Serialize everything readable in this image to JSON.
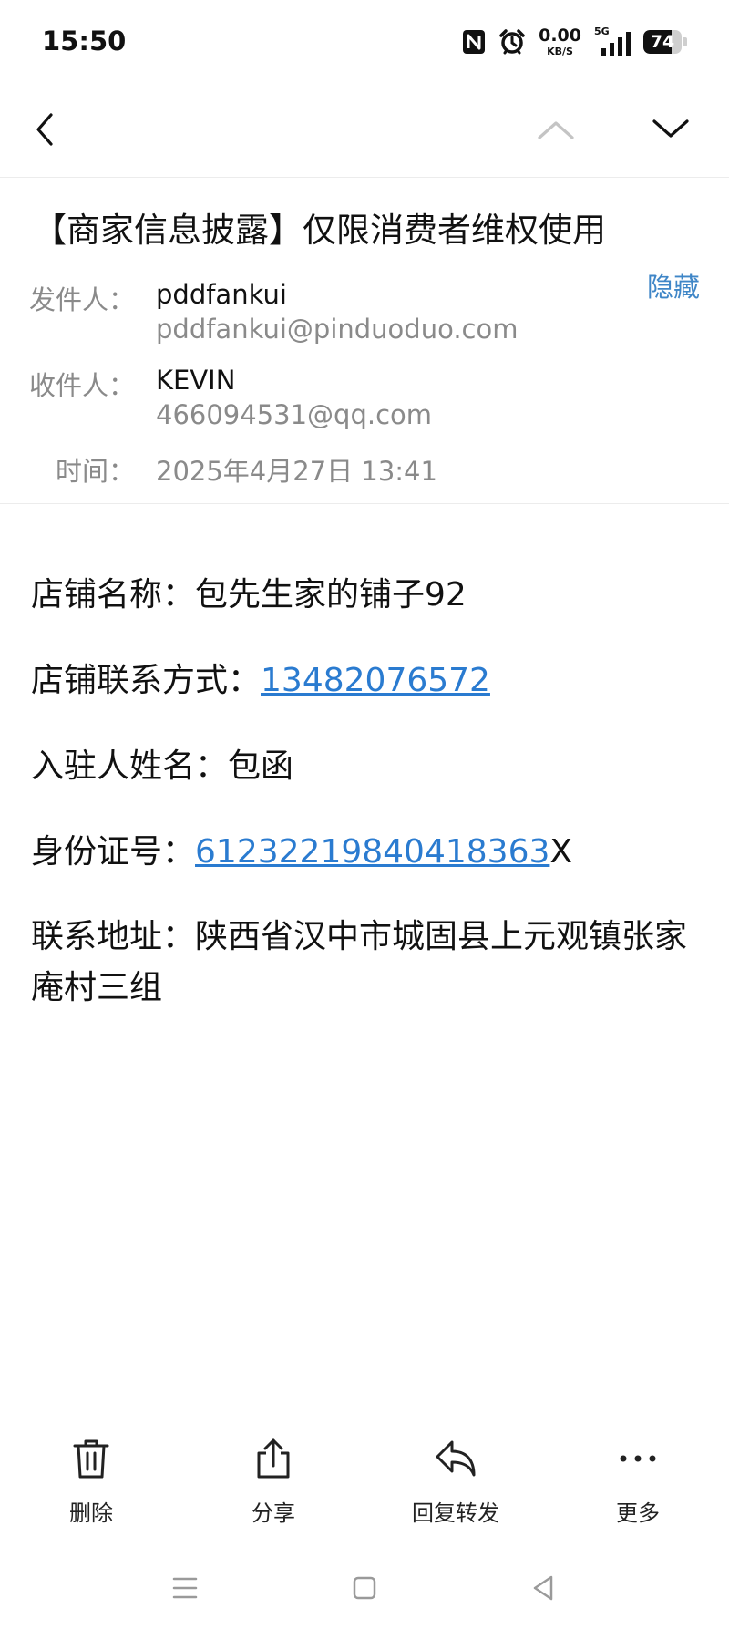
{
  "status_bar": {
    "time": "15:50",
    "net_speed_value": "0.00",
    "net_speed_unit": "KB/S",
    "network_type": "5G",
    "battery_level": "74",
    "battery_fraction": 0.74,
    "icons": [
      "nfc-icon",
      "alarm-icon",
      "signal-icon",
      "battery-icon"
    ]
  },
  "nav": {
    "icons": [
      "back-icon",
      "chevron-up-icon",
      "chevron-down-icon"
    ]
  },
  "email": {
    "subject": "【商家信息披露】仅限消费者维权使用",
    "hide_label": "隐藏",
    "from_label": "发件人：",
    "from_name": "pddfankui",
    "from_address": "pddfankui@pinduoduo.com",
    "to_label": "收件人：",
    "to_name": "KEVIN",
    "to_address": "466094531@qq.com",
    "time_label": "时间：",
    "time_value": "2025年4月27日 13:41"
  },
  "body": {
    "shop_name_label": "店铺名称：",
    "shop_name_value": "包先生家的铺子92",
    "contact_label": "店铺联系方式：",
    "contact_value": "13482076572",
    "owner_label": "入驻人姓名：",
    "owner_value": "包函",
    "id_label": "身份证号：",
    "id_link": "61232219840418363",
    "id_suffix": "X",
    "address_label": "联系地址：",
    "address_value": "陕西省汉中市城固县上元观镇张家庵村三组"
  },
  "toolbar": {
    "delete_label": "删除",
    "share_label": "分享",
    "reply_forward_label": "回复转发",
    "more_label": "更多"
  },
  "colors": {
    "link": "#2a7bd0",
    "hide_link": "#3f86c7",
    "meta_gray": "#8a8a8a"
  }
}
